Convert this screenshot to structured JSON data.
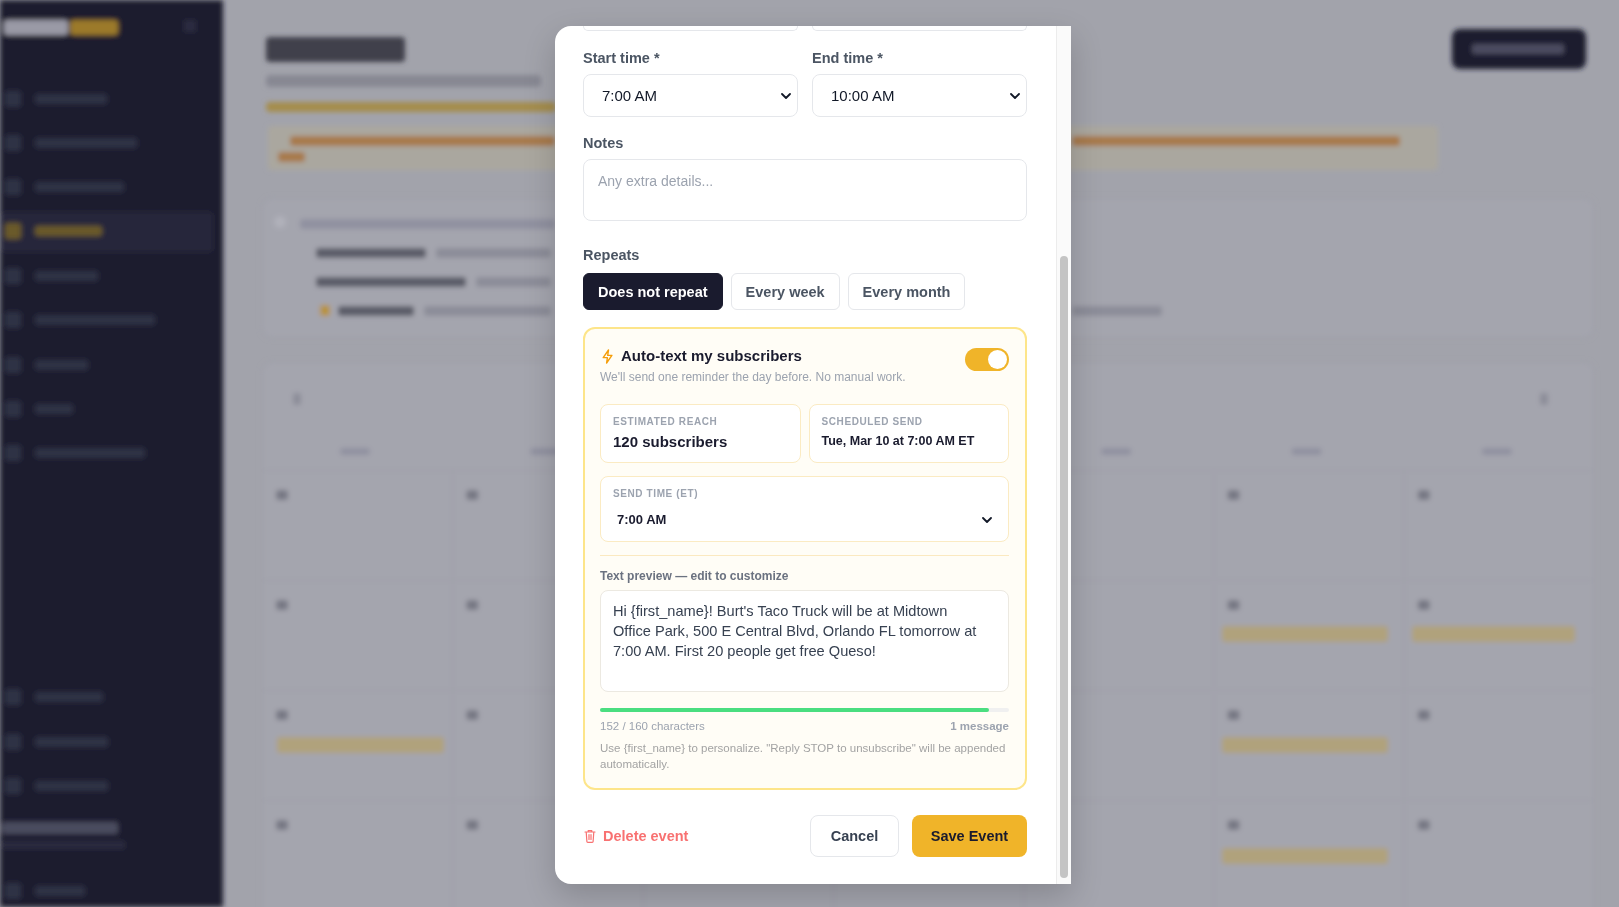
{
  "modal": {
    "top_fields": [
      {
        "kind": "input"
      },
      {
        "kind": "input"
      }
    ],
    "time_fields": [
      {
        "label": "Start time *",
        "value": "7:00 AM"
      },
      {
        "label": "End time *",
        "value": "10:00 AM"
      }
    ],
    "notes": {
      "label": "Notes",
      "placeholder": "Any extra details..."
    },
    "repeats": {
      "label": "Repeats",
      "options": [
        {
          "label": "Does not repeat",
          "selected": true
        },
        {
          "label": "Every week",
          "selected": false
        },
        {
          "label": "Every month",
          "selected": false
        }
      ]
    },
    "auto_text": {
      "title": "Auto-text my subscribers",
      "subtitle": "We'll send one reminder the day before. No manual work.",
      "enabled": true,
      "stats": [
        {
          "kind": "count",
          "label": "ESTIMATED REACH",
          "value": "120 subscribers"
        },
        {
          "kind": "datetime",
          "label": "SCHEDULED SEND",
          "value": "Tue, Mar 10 at 7:00 AM ET"
        }
      ],
      "send_time": {
        "label": "SEND TIME (ET)",
        "value": "7:00 AM"
      },
      "preview": {
        "label": "Text preview — edit to customize",
        "value": "Hi {first_name}! Burt's Taco Truck will be at Midtown Office Park, 500 E Central Blvd, Orlando FL tomorrow at 7:00 AM. First 20 people get free Queso!",
        "level": 0.95,
        "count": "152 / 160 characters",
        "messages": "1 message",
        "hint": "Use {first_name} to personalize. \"Reply STOP to unsubscribe\" will be appended automatically."
      }
    },
    "footer": {
      "delete": "Delete event",
      "cancel": "Cancel",
      "save": "Save Event"
    }
  }
}
